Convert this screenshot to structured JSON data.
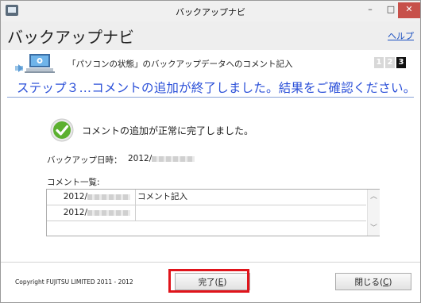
{
  "window": {
    "title": "バックアップナビ",
    "controls": {
      "minimize": "–",
      "maximize": "□",
      "close": "✕"
    }
  },
  "header": {
    "title": "バックアップナビ",
    "help_label": "ヘルプ"
  },
  "step": {
    "description": "「パソコンの状態」のバックアップデータへのコメント記入",
    "numbers": [
      "1",
      "2",
      "3"
    ],
    "current": "3"
  },
  "headline": "ステップ３…コメントの追加が終了しました。結果をご確認ください。",
  "result": {
    "message": "コメントの追加が正常に完了しました。",
    "date_label": "バックアップ日時：",
    "date_value_prefix": "2012/"
  },
  "comment_list": {
    "label": "コメント一覧:",
    "rows": [
      {
        "date_prefix": "2012/",
        "comment": "コメント記入"
      },
      {
        "date_prefix": "2012/",
        "comment": ""
      }
    ]
  },
  "footer": {
    "copyright": "Copyright FUJITSU LIMITED 2011 - 2012",
    "finish_label": "完了(",
    "finish_key": "E",
    "finish_suffix": ")",
    "close_label": "閉じる(",
    "close_key": "C",
    "close_suffix": ")"
  },
  "colors": {
    "headline": "#2a4fd8",
    "highlight": "#e0141b",
    "check": "#5cb030"
  },
  "icons": [
    "app-icon",
    "computer-gear-icon",
    "checkmark-icon",
    "scroll-up-icon",
    "scroll-down-icon"
  ]
}
